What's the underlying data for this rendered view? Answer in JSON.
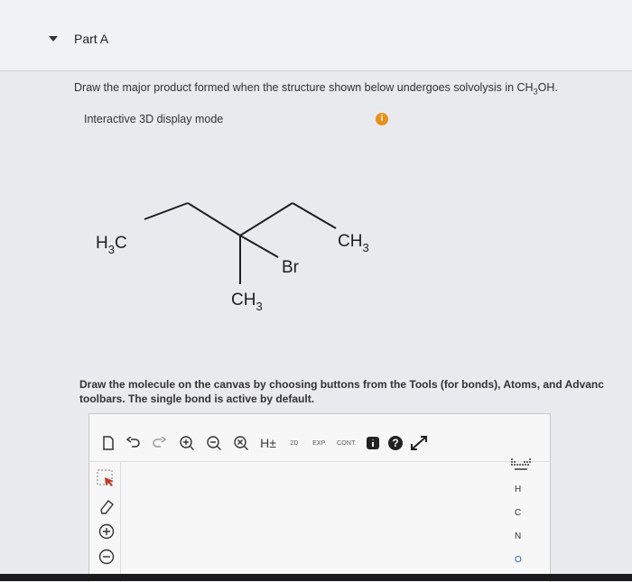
{
  "part": {
    "title": "Part A"
  },
  "question": {
    "prompt_pre": "Draw the major product formed when the structure shown below undergoes solvolysis in CH",
    "prompt_sub": "3",
    "prompt_post": "OH.",
    "display_mode": "Interactive 3D display mode",
    "info_icon": "i"
  },
  "molecule": {
    "left_main": "H",
    "left_sub": "3",
    "left_tail": "C",
    "right_main": "CH",
    "right_sub": "3",
    "bottom_main": "CH",
    "bottom_sub": "3",
    "substituent": "Br"
  },
  "instructions": "Draw the molecule on the canvas by choosing buttons from the Tools (for bonds), Atoms, and Advanc toolbars. The single bond is active by default.",
  "toolbar": {
    "hydrogens_label": "H±",
    "cleanup_2d_label": "2D",
    "explicit_label": "EXP.",
    "contract_label": "CONT.",
    "help_label": "?"
  },
  "atoms": [
    "H",
    "C",
    "N",
    "O"
  ],
  "colors": {
    "info": "#e8901a",
    "tool_accent": "#c0392b"
  }
}
